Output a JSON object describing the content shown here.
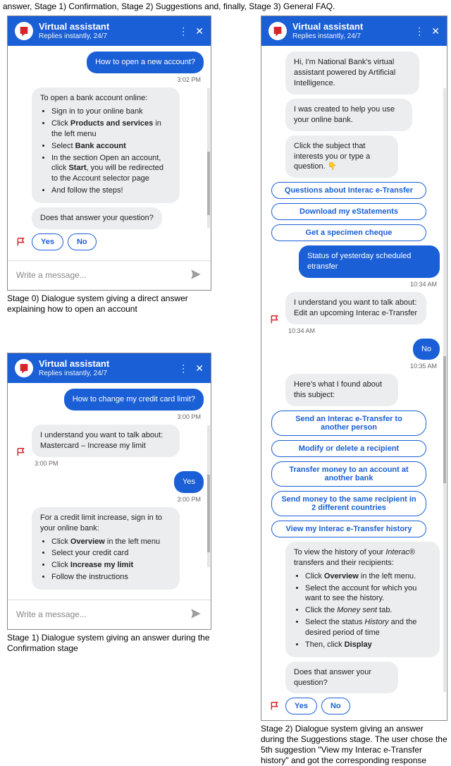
{
  "top_line": "answer, Stage 1) Confirmation, Stage 2) Suggestions and, finally, Stage 3) General FAQ.",
  "header": {
    "title": "Virtual assistant",
    "subtitle": "Replies instantly, 24/7"
  },
  "input_placeholder": "Write a message...",
  "stage0": {
    "user_msg": "How to open a new account?",
    "ts_user": "3:02 PM",
    "bot_intro": "To open a bank account online:",
    "steps": [
      "Sign in to your online bank",
      "Click <b>Products and services</b> in the left menu",
      "Select <b>Bank account</b>",
      "In the section Open an account, click <b>Start</b>, you will be redirected to the Account selector page",
      "And follow the steps!"
    ],
    "followup": "Does that answer your question?",
    "yes": "Yes",
    "no": "No",
    "caption": "Stage 0) Dialogue system giving a direct answer explaining how to open an account"
  },
  "stage1": {
    "user_msg": "How to change my credit card limit?",
    "ts_user": "3:00 PM",
    "bot_understand": "I understand you want to talk about: Mastercard – Increase my limit",
    "ts_bot1": "3:00 PM",
    "user_yes": "Yes",
    "ts_yes": "3:00 PM",
    "bot_answer_intro": "For a credit limit increase, sign in to your online bank:",
    "steps": [
      "Click <b>Overview</b> in the left menu",
      "Select your credit card",
      "Click <b>Increase my limit</b>",
      "Follow the instructions"
    ],
    "caption": "Stage 1) Dialogue system giving an answer during the Confirmation stage"
  },
  "stage2": {
    "intro1": "Hi, I'm National Bank's virtual assistant powered by Artificial Intelligence.",
    "intro2": "I was created to help you use your online bank.",
    "intro3": "Click the subject that interests you or type a question. 👇",
    "opts_a": [
      "Questions about Interac e-Transfer",
      "Download my eStatements",
      "Get a specimen cheque"
    ],
    "user_status": "Status of yesterday scheduled etransfer",
    "ts_status": "10:34 AM",
    "bot_understand": "I understand you want to talk about: Edit an upcoming Interac e-Transfer",
    "ts_understand": "10:34 AM",
    "user_no": "No",
    "ts_no": "10:35 AM",
    "bot_found": "Here's what I found about this subject:",
    "opts_b": [
      "Send an Interac e-Transfer to another person",
      "Modify or delete a recipient",
      "Transfer money to an account at another bank",
      "Send money to the same recipient in 2 different countries",
      "View my Interac e-Transfer history"
    ],
    "history_intro": "To view the history of your <i>Interac</i>® transfers and their recipients:",
    "history_steps": [
      "Click <b>Overview</b> in the left menu.",
      "Select the account for which you want to see the history.",
      "Click the <i>Money sent</i> tab.",
      "Select the status <i>History</i> and the desired period of time",
      "Then, click <b>Display</b>"
    ],
    "followup": "Does that answer your question?",
    "yes": "Yes",
    "no": "No",
    "caption": "Stage 2) Dialogue system giving an answer during the Suggestions stage. The user chose the 5th suggestion \"View my Interac e-Transfer history\" and got the corresponding response"
  }
}
